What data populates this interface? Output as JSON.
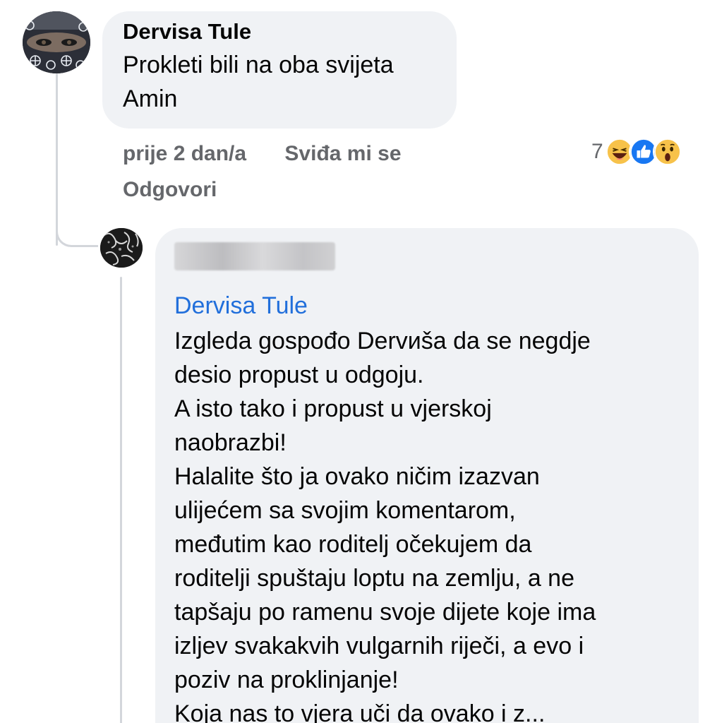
{
  "comment_1": {
    "author": "Dervisa Tule",
    "text": "Prokleti bili na oba svijeta\nAmin",
    "time": "prije 2 dan/a",
    "like_label": "Sviđa mi se",
    "reply_label": "Odgovori",
    "reaction_count": "7",
    "reactions": [
      "haha-emoji-icon",
      "like-icon",
      "wow-emoji-icon"
    ]
  },
  "comment_2": {
    "mention": "Dervisa Tule",
    "text": "Izgleda gospođo Dervиšа da se negdje\ndesio propust u odgoju.\nA isto tako i propust u vjerskoj\nnaobrazbi!\nHalalite što ja ovako ničim izazvan\nulijećem sa svojim komentarom,\nmeđutim kao roditelj očekujem da\nroditelji spuštaju loptu na zemlju, a ne\ntapšaju po ramenu svoje dijete koje ima\nizljev svakakvih vulgarnih riječi, a evo i\npoziv na proklinjanje!\nKoja nas to vjera uči da ovako i z..."
  },
  "colors": {
    "bubble": "#f0f2f5",
    "mention": "#216fdb",
    "meta": "#65676b",
    "like_blue": "#1877f2",
    "emoji_yellow": "#f7c24a"
  }
}
